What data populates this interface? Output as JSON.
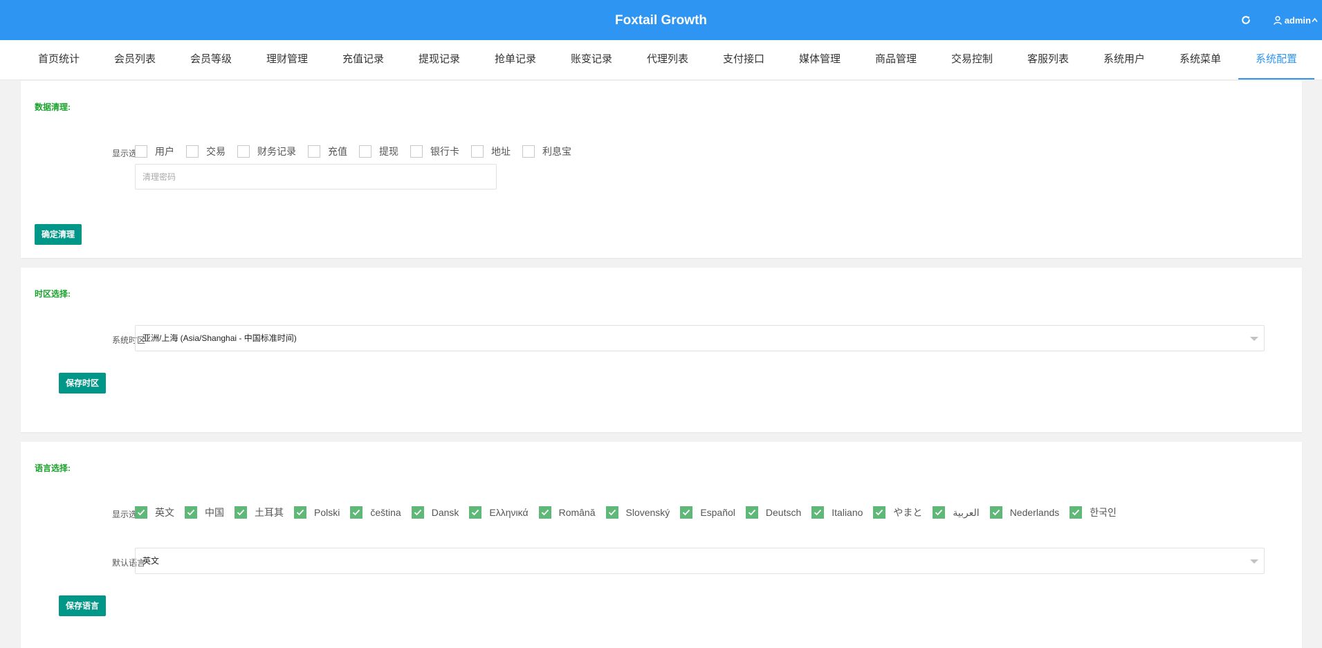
{
  "header": {
    "title": "Foxtail Growth",
    "refresh_icon": "refresh-icon",
    "user_icon": "user-icon",
    "user_name": "admin"
  },
  "nav": {
    "tabs": [
      {
        "label": "首页统计"
      },
      {
        "label": "会员列表"
      },
      {
        "label": "会员等级"
      },
      {
        "label": "理财管理"
      },
      {
        "label": "充值记录"
      },
      {
        "label": "提现记录"
      },
      {
        "label": "抢单记录"
      },
      {
        "label": "账变记录"
      },
      {
        "label": "代理列表"
      },
      {
        "label": "支付接口"
      },
      {
        "label": "媒体管理"
      },
      {
        "label": "商品管理"
      },
      {
        "label": "交易控制"
      },
      {
        "label": "客服列表"
      },
      {
        "label": "系统用户"
      },
      {
        "label": "系统菜单"
      },
      {
        "label": "系统配置",
        "active": true
      }
    ]
  },
  "data_clean": {
    "title": "数据清理:",
    "options_label": "显示选项",
    "options": [
      {
        "label": "用户",
        "checked": false
      },
      {
        "label": "交易",
        "checked": false
      },
      {
        "label": "财务记录",
        "checked": false
      },
      {
        "label": "充值",
        "checked": false
      },
      {
        "label": "提现",
        "checked": false
      },
      {
        "label": "银行卡",
        "checked": false
      },
      {
        "label": "地址",
        "checked": false
      },
      {
        "label": "利息宝",
        "checked": false
      }
    ],
    "password_value": "",
    "password_placeholder": "清理密码",
    "confirm_button": "确定清理"
  },
  "timezone": {
    "title": "时区选择:",
    "label": "系统时区",
    "selected": "亚洲/上海 (Asia/Shanghai - 中国标准时间)",
    "save_button": "保存时区"
  },
  "language": {
    "title": "语言选择:",
    "options_label": "显示选项",
    "options": [
      {
        "label": "英文",
        "checked": true
      },
      {
        "label": "中国",
        "checked": true
      },
      {
        "label": "土耳其",
        "checked": true
      },
      {
        "label": "Polski",
        "checked": true
      },
      {
        "label": "čeština",
        "checked": true
      },
      {
        "label": "Dansk",
        "checked": true
      },
      {
        "label": "Ελληνικά",
        "checked": true
      },
      {
        "label": "Română",
        "checked": true
      },
      {
        "label": "Slovenský",
        "checked": true
      },
      {
        "label": "Español",
        "checked": true
      },
      {
        "label": "Deutsch",
        "checked": true
      },
      {
        "label": "Italiano",
        "checked": true
      },
      {
        "label": "やまと",
        "checked": true
      },
      {
        "label": "العربية",
        "checked": true
      },
      {
        "label": "Nederlands",
        "checked": true
      },
      {
        "label": "한국인",
        "checked": true
      }
    ],
    "default_label": "默认语言",
    "default_selected": "英文",
    "save_button": "保存语言"
  },
  "colors": {
    "primary": "#2f95f3",
    "section_title": "#1aa32a",
    "button": "#009688",
    "checkbox_checked": "#5fb878"
  }
}
